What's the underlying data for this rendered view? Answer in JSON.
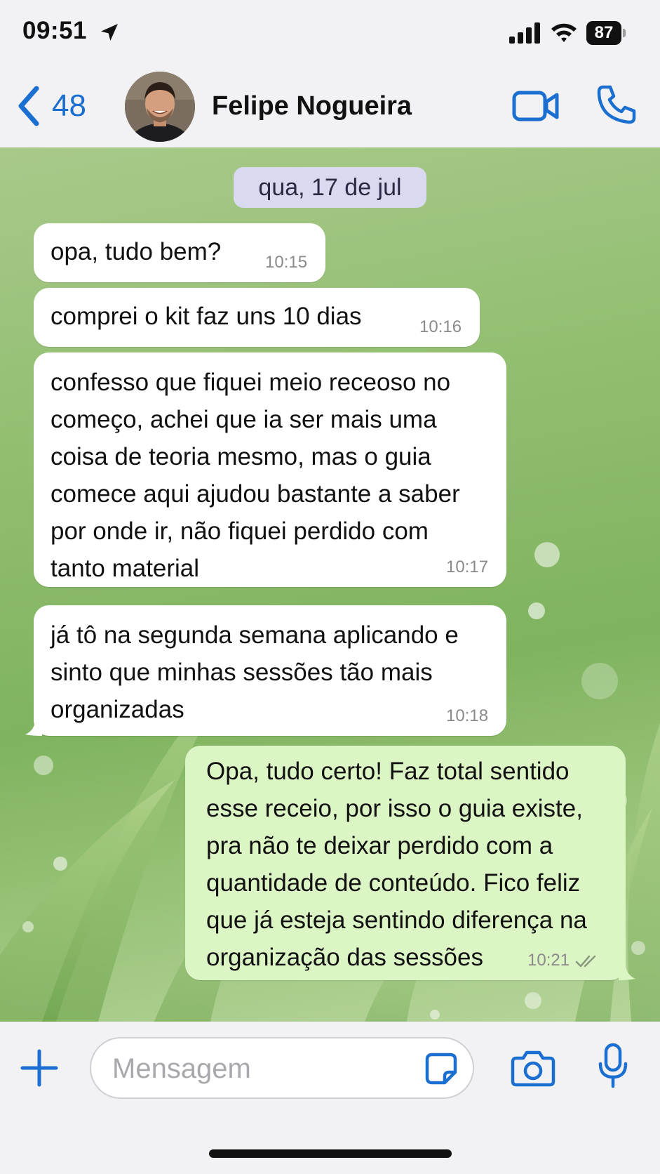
{
  "status_bar": {
    "time": "09:51",
    "battery": "87"
  },
  "header": {
    "back_count": "48",
    "contact_name": "Felipe Nogueira"
  },
  "chat": {
    "date_label": "qua, 17 de jul",
    "messages": [
      {
        "direction": "incoming",
        "text": "opa, tudo bem?",
        "time": "10:15"
      },
      {
        "direction": "incoming",
        "text": "comprei o kit faz uns 10 dias",
        "time": "10:16"
      },
      {
        "direction": "incoming",
        "text": "confesso que fiquei meio receoso no\ncomeço, achei que ia ser mais uma\ncoisa de teoria mesmo, mas o guia\ncomece aqui ajudou bastante a saber\npor onde ir, não fiquei perdido com\ntanto material",
        "time": "10:17"
      },
      {
        "direction": "incoming",
        "text": "já tô na segunda semana aplicando e\nsinto que minhas sessões tão mais\norganizadas",
        "time": "10:18"
      },
      {
        "direction": "outgoing",
        "text": "Opa, tudo certo! Faz total sentido\nesse receio, por isso o guia existe,\npra não te deixar perdido com a\nquantidade de conteúdo. Fico feliz\nque já esteja sentindo diferença na\norganização das sessões",
        "time": "10:21",
        "status_icon": "double-check-icon"
      }
    ]
  },
  "input": {
    "placeholder": "Mensagem"
  },
  "colors": {
    "accent": "#1b6fd0",
    "incoming_bubble": "#ffffff",
    "outgoing_bubble": "#dcf5c4",
    "date_chip": "#d9d9f0"
  }
}
